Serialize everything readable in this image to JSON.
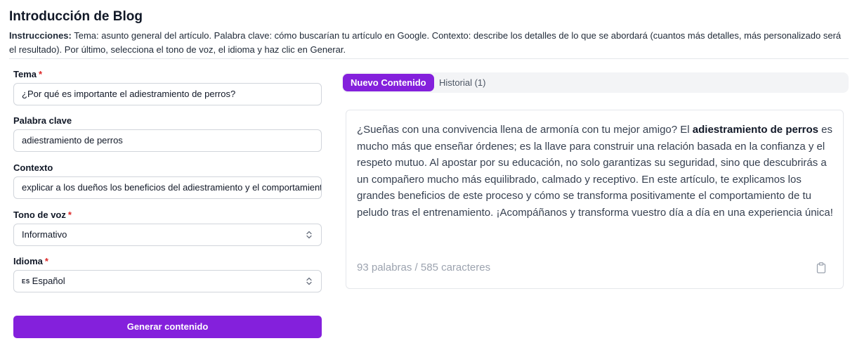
{
  "header": {
    "title": "Introducción de Blog",
    "instructions_label": "Instrucciones:",
    "instructions_text": " Tema: asunto general del artículo. Palabra clave: cómo buscarían tu artículo en Google. Contexto: describe los detalles de lo que se abordará (cuantos más detalles, más personalizado será el resultado). Por último, selecciona el tono de voz, el idioma y haz clic en Generar."
  },
  "form": {
    "tema": {
      "label": "Tema",
      "required": "*",
      "value": "¿Por qué es importante el adiestramiento de perros?"
    },
    "palabra_clave": {
      "label": "Palabra clave",
      "value": "adiestramiento de perros"
    },
    "contexto": {
      "label": "Contexto",
      "value": "explicar a los dueños los beneficios del adiestramiento y el comportamiento del perro tras el entrenamiento"
    },
    "tono": {
      "label": "Tono de voz",
      "required": "*",
      "value": "Informativo"
    },
    "idioma": {
      "label": "Idioma",
      "required": "*",
      "flag": "ES",
      "value": "Español"
    },
    "generate_label": "Generar contenido"
  },
  "tabs": [
    {
      "label": "Nuevo Contenido",
      "active": true
    },
    {
      "label": "Historial (1)",
      "active": false
    }
  ],
  "result": {
    "part1": "¿Sueñas con una convivencia llena de armonía con tu mejor amigo? El ",
    "bold": "adiestramiento de perros",
    "part2": " es mucho más que enseñar órdenes; es la llave para construir una relación basada en la confianza y el respeto mutuo. Al apostar por su educación, no solo garantizas su seguridad, sino que descubrirás a un compañero mucho más equilibrado, calmado y receptivo. En este artículo, te explicamos los grandes beneficios de este proceso y cómo se transforma positivamente el comportamiento de tu peludo tras el entrenamiento. ¡Acompáñanos y transforma vuestro día a día en una experiencia única!",
    "counts": "93 palabras / 585 caracteres"
  },
  "colors": {
    "accent": "#8420dc",
    "required": "#dc2626"
  },
  "icons": {
    "select": "chevron-up-down-icon",
    "copy": "clipboard-icon"
  }
}
